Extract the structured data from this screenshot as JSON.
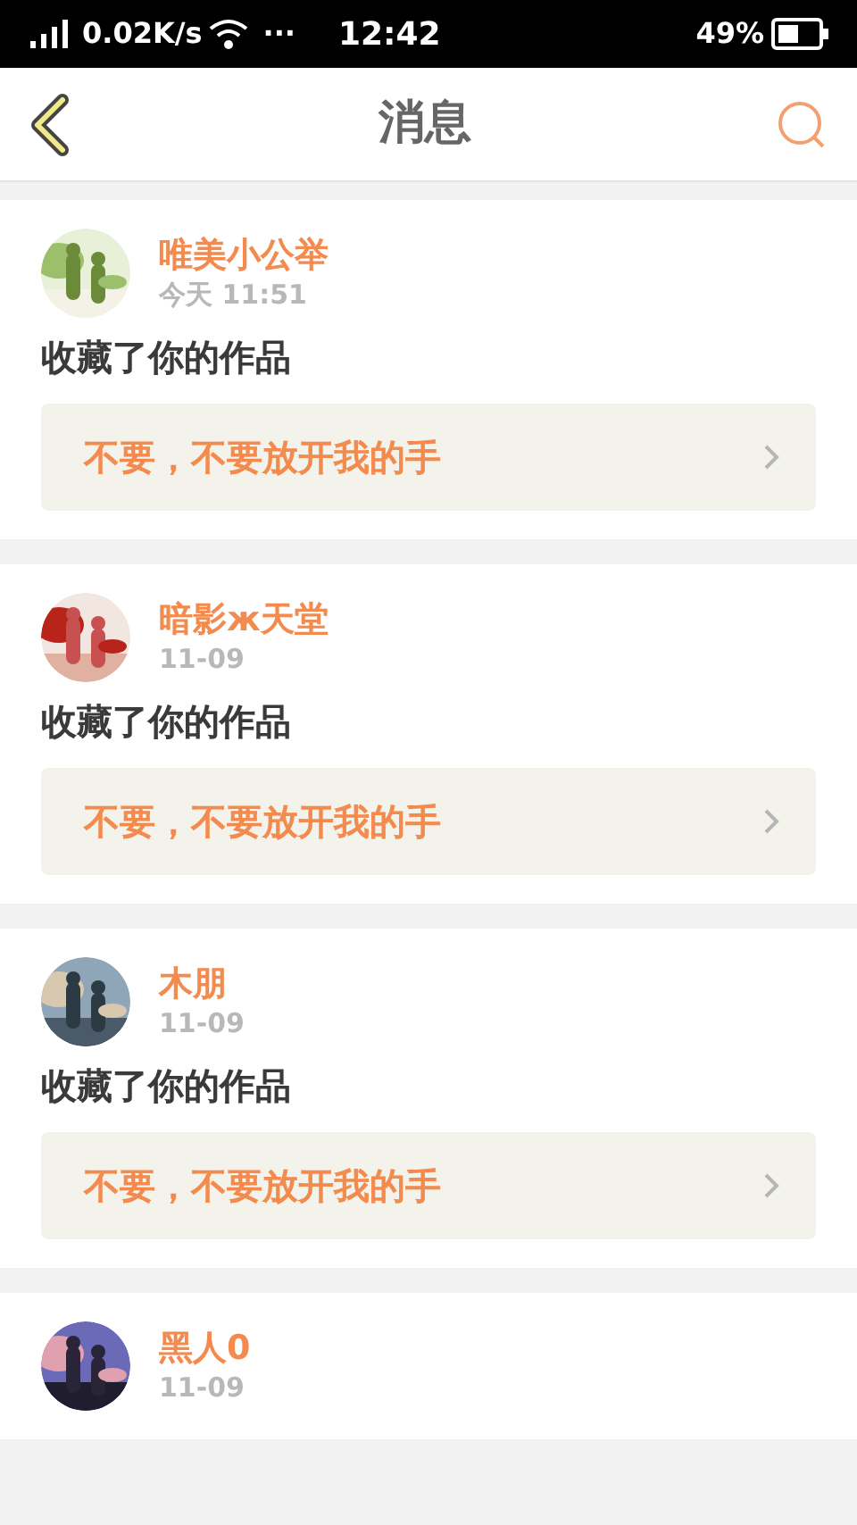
{
  "status_bar": {
    "speed": "0.02K/s",
    "more": "···",
    "time": "12:42",
    "battery": "49%"
  },
  "header": {
    "title": "消息"
  },
  "messages": [
    {
      "user": "唯美小公举",
      "time": "今天 11:51",
      "action": "收藏了你的作品",
      "work": "不要，不要放开我的手"
    },
    {
      "user": "暗影ж天堂",
      "time": "11-09",
      "action": "收藏了你的作品",
      "work": "不要，不要放开我的手"
    },
    {
      "user": "木朋",
      "time": "11-09",
      "action": "收藏了你的作品",
      "work": "不要，不要放开我的手"
    },
    {
      "user": "黑人0",
      "time": "11-09"
    }
  ]
}
